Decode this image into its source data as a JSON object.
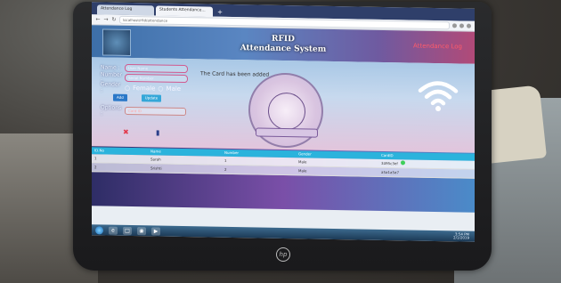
{
  "browser": {
    "tabs": [
      {
        "label": "Attendance Log"
      },
      {
        "label": "Students Attendance..."
      }
    ],
    "url": "localhost/rfid/attendance"
  },
  "header": {
    "title_line1": "RFID",
    "title_line2": "Attendance System",
    "log_link": "Attendance Log"
  },
  "form": {
    "name_label": "Name :",
    "name_placeholder": "User Name",
    "number_label": "Number :",
    "number_placeholder": "Serial Number",
    "gender_label": "Gender :",
    "gender_female": "Female",
    "gender_male": "Male",
    "add_button": "Add",
    "update_button": "Update",
    "options_label": "Options :",
    "card_placeholder": "Card ID"
  },
  "message": "The Card has been added",
  "table": {
    "columns": [
      "ID.No",
      "Name",
      "Number",
      "Gender",
      "CardID"
    ],
    "rows": [
      {
        "id": "1",
        "name": "Sarah",
        "number": "1",
        "gender": "Male",
        "card": "3495c3ef"
      },
      {
        "id": "2",
        "name": "Srishti",
        "number": "2",
        "gender": "Male",
        "card": "a5a1a5a7"
      }
    ]
  },
  "taskbar": {
    "time": "3:54 PM",
    "date": "2/1/2019"
  },
  "colors": {
    "header_left": "#3d6fa8",
    "header_right": "#b14a78",
    "table_header": "#2bb3dc",
    "log_link": "#ff5b6a"
  }
}
